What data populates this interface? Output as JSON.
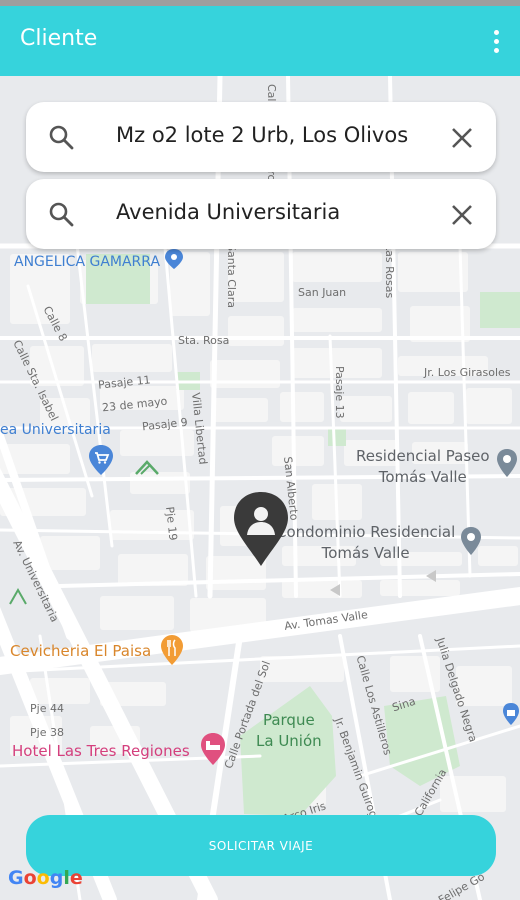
{
  "app_bar": {
    "title": "Cliente",
    "menu_icon": "more-vert-icon",
    "color": "#36d3dc"
  },
  "search": {
    "origin": {
      "value": "Mz o2 lote 2 Urb, Los Olivos",
      "icon": "search-icon",
      "clear_icon": "close-icon"
    },
    "destination": {
      "value": "Avenida Universitaria",
      "icon": "search-icon",
      "clear_icon": "close-icon"
    }
  },
  "map": {
    "pois": {
      "angelica": "ANGELICA GAMARRA",
      "universitaria": "ea Universitaria",
      "residencial_paseo_1": "Residencial Paseo",
      "residencial_paseo_2": "Tomás Valle",
      "condominio_1": "Condominio Residencial",
      "condominio_2": "Tomás Valle",
      "cevicheria": "Cevicheria El Paisa",
      "hotel": "Hotel Las Tres Regiones",
      "parque_1": "Parque",
      "parque_2": "La Unión"
    },
    "streets": {
      "calle8": "Calle 8",
      "sta_isabel": "Calle Sta. Isabel",
      "sta_clara": "Santa Clara",
      "san_juan": "San Juan",
      "las_rosas": "Las Rosas",
      "sta_rosa": "Sta. Rosa",
      "pasaje11": "Pasaje 11",
      "mayo": "23 de mayo",
      "pasaje9": "Pasaje 9",
      "villa_libertad": "Villa Libertad",
      "pasaje13": "Pasaje 13",
      "girasoles": "Jr. Los Girasoles",
      "san_alberto": "San Alberto",
      "pje19": "Pje 19",
      "av_univ": "Av. Universitaria",
      "tomas_valle": "Av. Tomas Valle",
      "portada": "Calle Portada del Sol",
      "los_astilleros": "Calle Los Astilleros",
      "julia": "Julia Delgado Negra",
      "benjamin": "Jr. Benjamin Guiroga",
      "pje44": "Pje 44",
      "pje38": "Pje 38",
      "arco_iris": "Arco Iris",
      "sina": "Sina",
      "california": "California",
      "felipe": "Felipe Go"
    },
    "attribution": "Google"
  },
  "marker": {
    "icon": "person-pin-icon"
  },
  "request_button": {
    "label": "SOLICITAR VIAJE"
  }
}
